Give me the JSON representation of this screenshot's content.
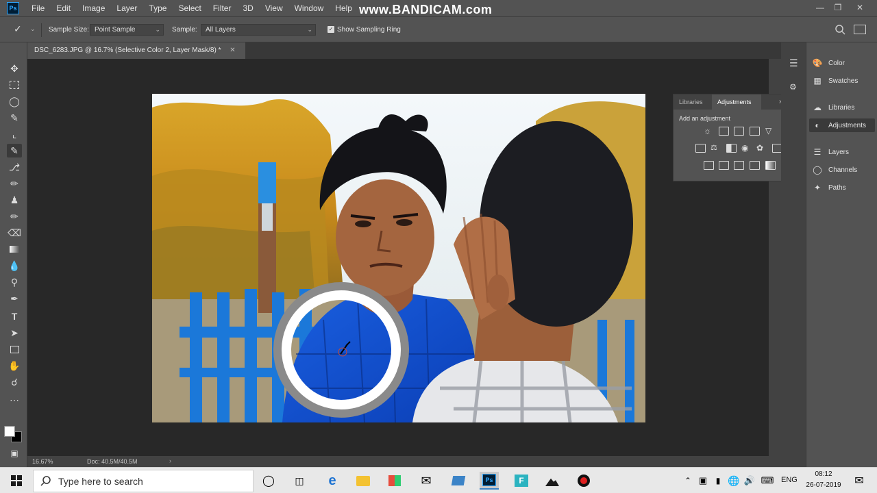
{
  "menu": {
    "logo": "Ps",
    "items": [
      "File",
      "Edit",
      "Image",
      "Layer",
      "Type",
      "Select",
      "Filter",
      "3D",
      "View",
      "Window",
      "Help"
    ],
    "watermark": "www.BANDICAM.com"
  },
  "options_bar": {
    "sample_size_label": "Sample Size:",
    "sample_size_value": "Point Sample",
    "sample_label": "Sample:",
    "sample_value": "All Layers",
    "sampling_ring_label": "Show Sampling Ring",
    "sampling_ring_checked": true
  },
  "document": {
    "tab_title": "DSC_6283.JPG @ 16.7% (Selective Color 2, Layer Mask/8) *",
    "zoom": "16.67%",
    "doc_info": "Doc: 40.5M/40.5M"
  },
  "adjustments_panel": {
    "tabs": [
      "Libraries",
      "Adjustments"
    ],
    "active_tab": "Adjustments",
    "heading": "Add an adjustment"
  },
  "right_panel": {
    "items": [
      "Color",
      "Swatches",
      "Libraries",
      "Adjustments",
      "Layers",
      "Channels",
      "Paths"
    ],
    "active": "Adjustments"
  },
  "taskbar": {
    "search_placeholder": "Type here to search",
    "language": "ENG",
    "time": "08:12",
    "date": "26-07-2019"
  },
  "colors": {
    "ps_dark": "#535353",
    "ps_canvas": "#282828",
    "ps_accent": "#31a8ff",
    "sky": "#f3f7fb",
    "fence": "#1b78d9"
  }
}
